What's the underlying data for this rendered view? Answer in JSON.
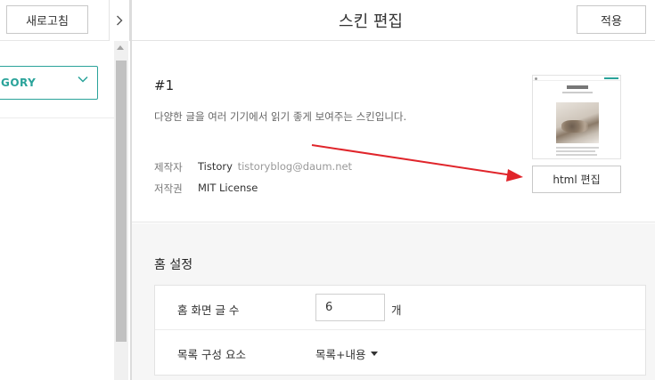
{
  "left": {
    "refresh_label": "새로고침",
    "category_label": "GORY"
  },
  "header": {
    "title": "스킨 편집",
    "apply_label": "적용"
  },
  "skin": {
    "number": "#1",
    "description": "다양한 글을 여러 기기에서 읽기 좋게 보여주는 스킨입니다.",
    "maker_label": "제작자",
    "maker_name": "Tistory",
    "maker_email": "tistoryblog@daum.net",
    "license_label": "저작권",
    "license_value": "MIT License",
    "html_edit_label": "html 편집"
  },
  "home_settings": {
    "title": "홈 설정",
    "post_count_label": "홈 화면 글 수",
    "post_count_value": "6",
    "post_count_unit": "개",
    "list_component_label": "목록 구성 요소",
    "list_component_value": "목록+내용"
  },
  "colors": {
    "accent": "#2aa39a",
    "annotation_arrow": "#e0252b"
  }
}
